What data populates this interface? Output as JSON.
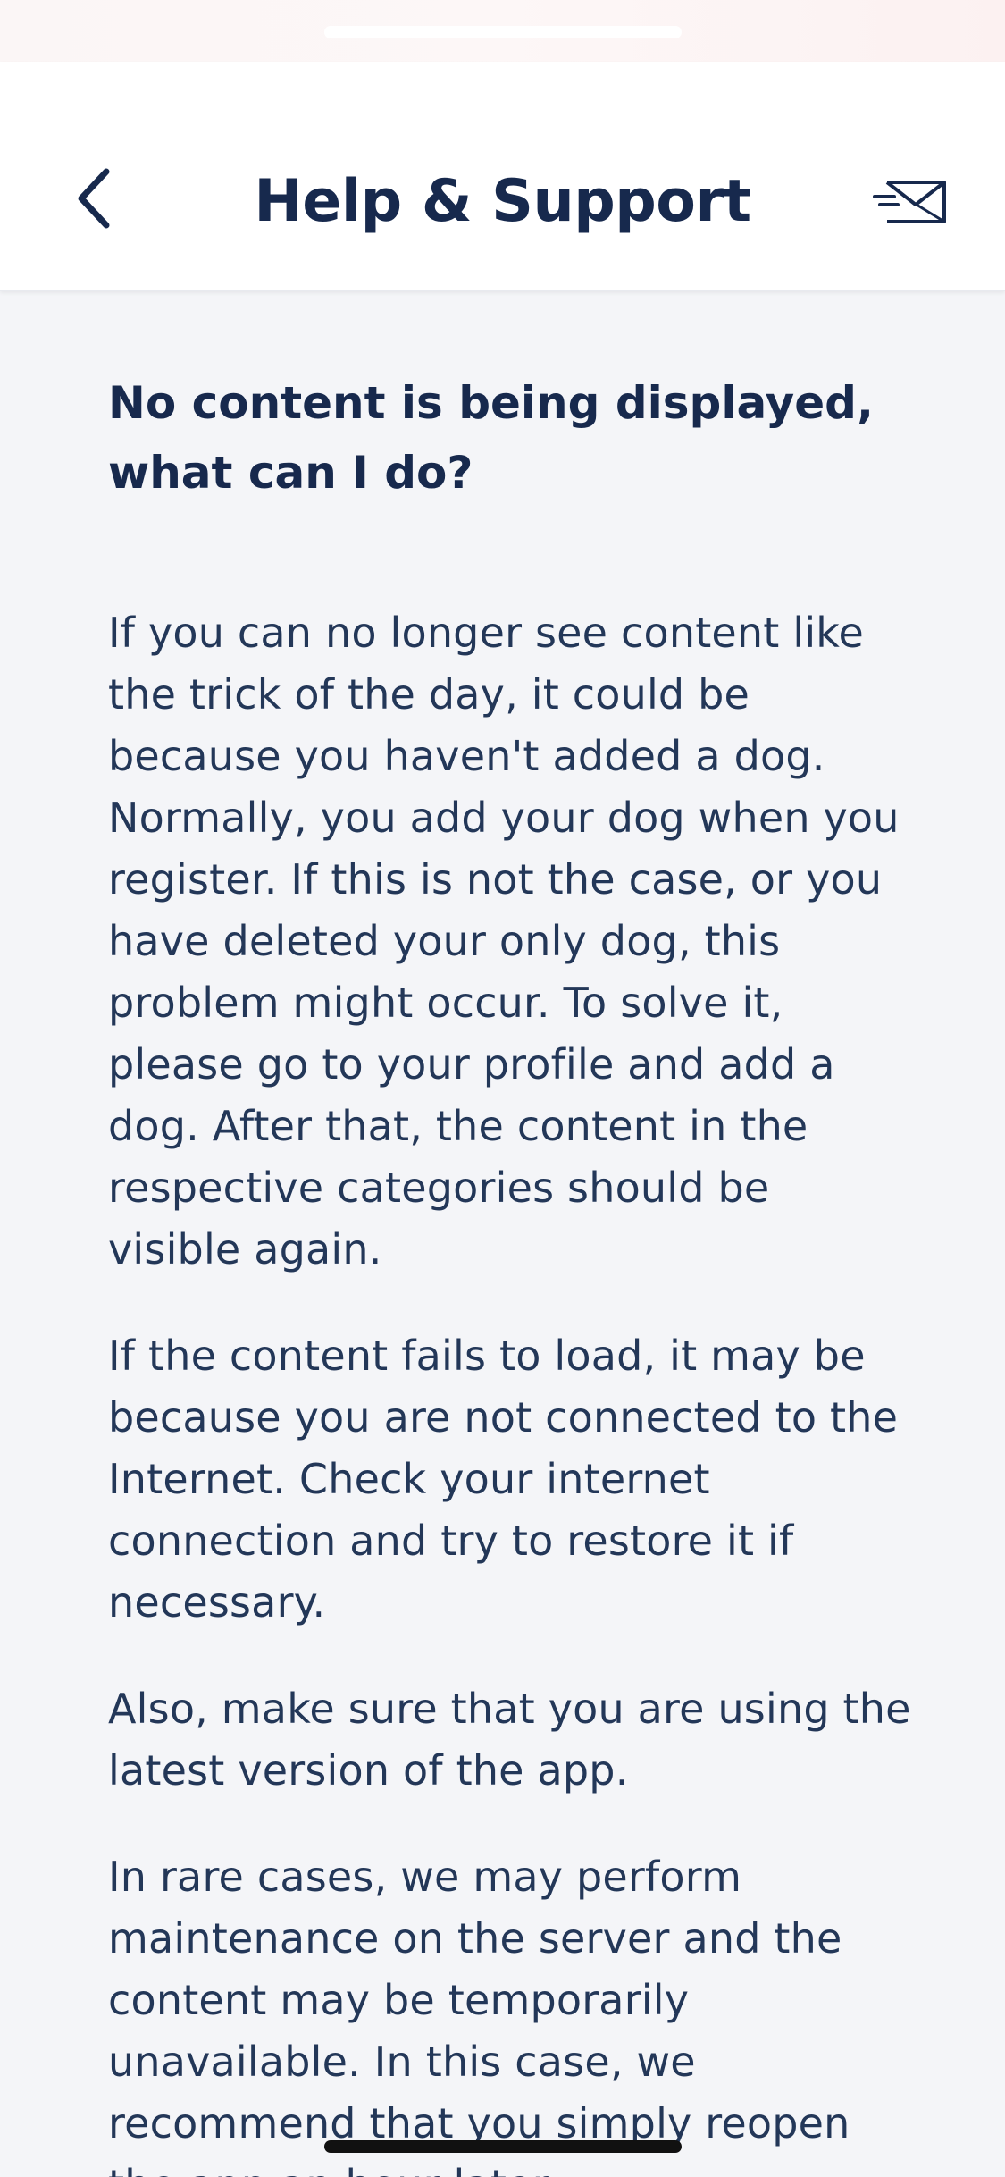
{
  "header": {
    "title": "Help & Support",
    "back_icon": "chevron-left-icon",
    "mail_icon": "fast-mail-icon"
  },
  "faq": {
    "question": "No content is being displayed, what can I do?",
    "paragraphs": [
      "If you can no longer see content like the trick of the day, it could be because you haven't added a dog. Normally, you add your dog when you register. If this is not the case, or you have deleted your only dog, this problem might occur. To solve it, please go to your profile and add a dog. After that, the content in the respective categories should be visible again.",
      "If the content fails to load, it may be because you are not connected to the Internet. Check your internet connection and try to restore it if necessary.",
      "Also, make sure that you are using the latest version of the app.",
      "In rare cases, we may perform maintenance on the server and the content may be temporarily unavailable. In this case, we recommend that you simply reopen the app an hour later."
    ]
  },
  "colors": {
    "primary_text": "#17294d",
    "body_text": "#233758",
    "background": "#f4f5f8",
    "header_background": "#ffffff"
  }
}
